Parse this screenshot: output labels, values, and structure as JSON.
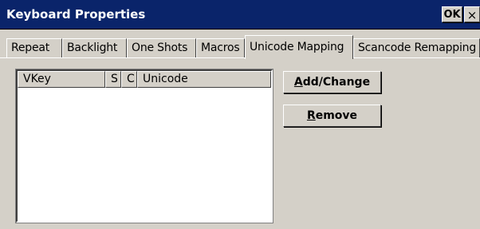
{
  "window": {
    "title": "Keyboard Properties",
    "ok_label": "OK",
    "close_label": "×"
  },
  "tabs": [
    {
      "label": "Repeat",
      "active": false
    },
    {
      "label": "Backlight",
      "active": false
    },
    {
      "label": "One Shots",
      "active": false
    },
    {
      "label": "Macros",
      "active": false
    },
    {
      "label": "Unicode Mapping",
      "active": true
    },
    {
      "label": "Scancode Remapping",
      "active": false
    }
  ],
  "list": {
    "columns": [
      "VKey",
      "S",
      "C",
      "Unicode"
    ],
    "rows": []
  },
  "buttons": {
    "add_change": {
      "mnemonic": "A",
      "rest": "dd/Change"
    },
    "remove": {
      "mnemonic": "R",
      "rest": "emove"
    }
  },
  "colors": {
    "titlebar": "#0a246a",
    "face": "#d4d0c8"
  }
}
